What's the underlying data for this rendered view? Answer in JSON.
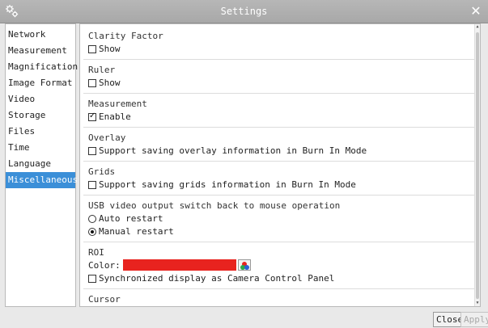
{
  "window": {
    "title": "Settings",
    "close_glyph": "✕",
    "app_icon": "gear-icon"
  },
  "sidebar": {
    "items": [
      {
        "label": "Network"
      },
      {
        "label": "Measurement"
      },
      {
        "label": "Magnification"
      },
      {
        "label": "Image Format"
      },
      {
        "label": "Video"
      },
      {
        "label": "Storage"
      },
      {
        "label": "Files"
      },
      {
        "label": "Time"
      },
      {
        "label": "Language"
      },
      {
        "label": "Miscellaneous"
      }
    ],
    "active_index": 9
  },
  "sections": {
    "clarity": {
      "title": "Clarity Factor",
      "option": "Show",
      "checked": false
    },
    "ruler": {
      "title": "Ruler",
      "option": "Show",
      "checked": false
    },
    "measurement": {
      "title": "Measurement",
      "option": "Enable",
      "checked": true
    },
    "overlay": {
      "title": "Overlay",
      "option": "Support saving overlay information in Burn In Mode",
      "checked": false
    },
    "grids": {
      "title": "Grids",
      "option": "Support saving grids information in Burn In Mode",
      "checked": false
    },
    "usb": {
      "title": "USB video output switch back to mouse operation",
      "option_auto": "Auto restart",
      "option_manual": "Manual restart",
      "selected": "Manual restart"
    },
    "roi": {
      "title": "ROI",
      "color_label": "Color:",
      "color_value": "#e8231f",
      "sync_option": "Synchronized display as Camera Control Panel",
      "sync_checked": false
    },
    "cursor": {
      "title": "Cursor"
    }
  },
  "buttons": {
    "close": "Close",
    "apply": "Apply"
  },
  "colors": {
    "accent": "#3b8fd8",
    "titlebar": "#aeaeae",
    "roi_color": "#e8231f"
  }
}
